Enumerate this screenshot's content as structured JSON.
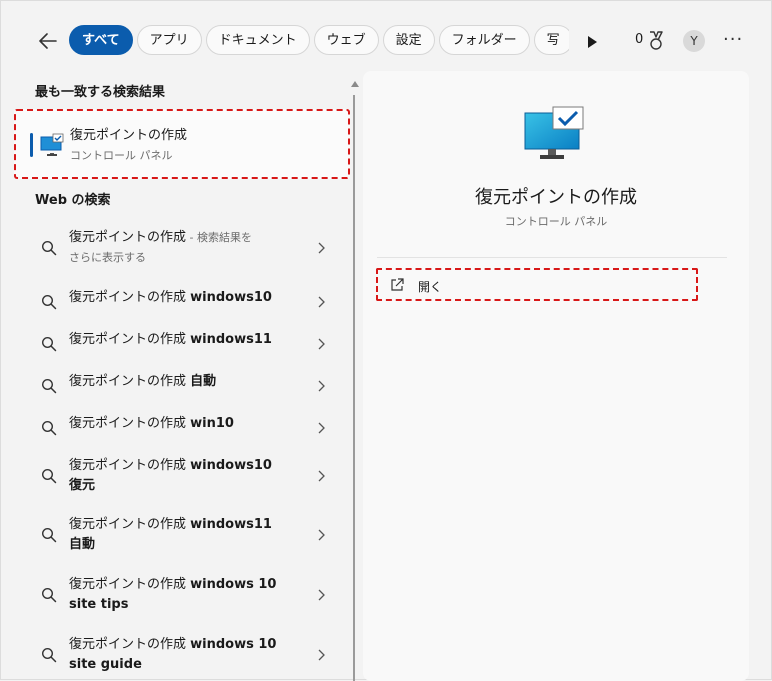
{
  "header": {
    "tabs": [
      "すべて",
      "アプリ",
      "ドキュメント",
      "ウェブ",
      "設定",
      "フォルダー",
      "写"
    ],
    "count": "0",
    "avatar_initial": "Y"
  },
  "left": {
    "best_match_heading": "最も一致する検索結果",
    "best_match": {
      "title": "復元ポイントの作成",
      "subtitle": "コントロール パネル"
    },
    "web_heading": "Web の検索",
    "web_items": [
      {
        "prefix": "復元ポイントの作成",
        "muted": " - 検索結果を",
        "line2_muted": "さらに表示する"
      },
      {
        "prefix": "復元ポイントの作成 ",
        "bold": "windows10"
      },
      {
        "prefix": "復元ポイントの作成 ",
        "bold": "windows11"
      },
      {
        "prefix": "復元ポイントの作成 ",
        "bold": "自動"
      },
      {
        "prefix": "復元ポイントの作成 ",
        "bold": "win10"
      },
      {
        "prefix": "復元ポイントの作成 ",
        "bold": "windows10",
        "line2_bold": "復元"
      },
      {
        "prefix": "復元ポイントの作成 ",
        "bold": "windows11",
        "line2_bold": "自動"
      },
      {
        "prefix": "復元ポイントの作成 ",
        "bold": "windows 10",
        "line2_bold": "site tips"
      },
      {
        "prefix": "復元ポイントの作成 ",
        "bold": "windows 10",
        "line2_bold": "site guide"
      }
    ]
  },
  "right": {
    "title": "復元ポイントの作成",
    "subtitle": "コントロール パネル",
    "action_open": "開く"
  }
}
